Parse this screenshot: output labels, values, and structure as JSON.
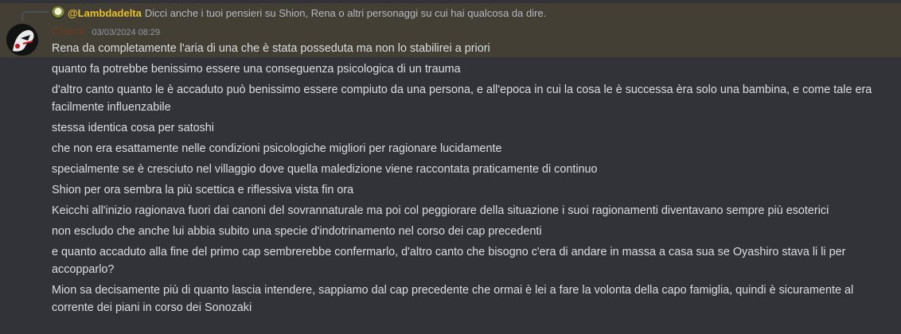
{
  "reply": {
    "author": "@Lambdadelta",
    "text": "Dicci anche i tuoi pensieri su Shion, Rena o altri personaggi su cui hai qualcosa da dire."
  },
  "message": {
    "author": "Check",
    "timestamp": "03/03/2024 08:29",
    "lines": [
      "Rena da completamente l'aria di una che è stata posseduta ma non lo stabilirei a priori",
      "quanto fa potrebbe benissimo essere una conseguenza psicologica di un trauma",
      "d'altro canto quanto le è accaduto può benissimo essere compiuto da una persona, e all'epoca in cui la cosa le è successa èra solo una bambina, e come tale era facilmente influenzabile",
      "stessa identica cosa per satoshi",
      "che non era esattamente nelle condizioni psicologiche migliori per ragionare lucidamente",
      "specialmente se è cresciuto nel villaggio dove quella maledizione viene raccontata praticamente di continuo",
      "Shion per ora sembra la più scettica e riflessiva vista fin ora",
      "Keicchi all'inizio ragionava fuori dai canoni del sovrannaturale ma poi col peggiorare della situazione i suoi ragionamenti diventavano sempre più esoterici",
      "non escludo che anche lui abbia subito una specie d'indotrinamento nel corso dei cap precedenti",
      "e quanto accaduto alla fine del primo cap sembrerebbe confermarlo, d'altro canto che bisogno c'era di andare in massa a casa sua se Oyashiro stava li li per accopparlo?",
      "Mion sa decisamente più di quanto lascia intendere, sappiamo dal cap precedente che ormai è lei a fare la volonta della capo famiglia, quindi è sicuramente al corrente dei piani in corso dei Sonozaki"
    ]
  },
  "colors": {
    "background": "#313338",
    "highlight": "#433f35",
    "reply_name": "#e6c12b",
    "author": "#6b3a1f",
    "text": "#dbdee1",
    "muted": "#949ba4"
  },
  "icons": {
    "reply_avatar": "lambdadelta-avatar-icon",
    "author_avatar": "check-avatar-icon"
  }
}
